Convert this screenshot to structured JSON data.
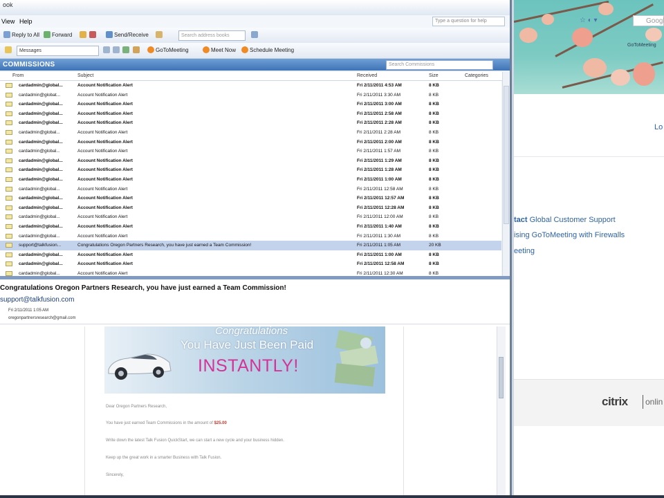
{
  "outlook": {
    "title_fragment": "ook",
    "menu": {
      "view": "View",
      "help": "Help"
    },
    "search_help_placeholder": "Type a question for help",
    "toolbar1": {
      "reply_to_all": "Reply to All",
      "forward": "Forward",
      "send_receive": "Send/Receive",
      "search_address_books": "Search address books"
    },
    "toolbar2": {
      "messages_select": "Messages",
      "gotomeeting": "GoToMeeting",
      "meet_now": "Meet Now",
      "schedule_meeting": "Schedule Meeting"
    },
    "folder": {
      "name": "COMMISSIONS",
      "search_placeholder": "Search Commissions"
    },
    "columns": {
      "from": "From",
      "subject": "Subject",
      "received": "Received",
      "size": "Size",
      "categories": "Categories"
    },
    "messages": [
      {
        "from": "cardadmin@global...",
        "subject": "Account Notification Alert",
        "received": "Fri 2/11/2011 4:53 AM",
        "size": "8 KB",
        "bold": true,
        "selected": false
      },
      {
        "from": "cardadmin@globat...",
        "subject": "Account Notification Alert",
        "received": "Fri 2/11/2011 3:30 AM",
        "size": "8 KB",
        "bold": false,
        "selected": false
      },
      {
        "from": "cardadmin@global...",
        "subject": "Account Notification Alert",
        "received": "Fri 2/11/2011 3:00 AM",
        "size": "8 KB",
        "bold": true,
        "selected": false
      },
      {
        "from": "cardadmin@global...",
        "subject": "Account Notification Alert",
        "received": "Fri 2/11/2011 2:58 AM",
        "size": "8 KB",
        "bold": true,
        "selected": false
      },
      {
        "from": "cardadmin@global...",
        "subject": "Account Notification Alert",
        "received": "Fri 2/11/2011 2:28 AM",
        "size": "8 KB",
        "bold": true,
        "selected": false
      },
      {
        "from": "cardadmin@global...",
        "subject": "Account Notification Alert",
        "received": "Fri 2/11/2011 2:28 AM",
        "size": "8 KB",
        "bold": false,
        "selected": false
      },
      {
        "from": "cardadmin@global...",
        "subject": "Account Notification Alert",
        "received": "Fri 2/11/2011 2:00 AM",
        "size": "8 KB",
        "bold": true,
        "selected": false
      },
      {
        "from": "cardadmin@global...",
        "subject": "Account Notification Alert",
        "received": "Fri 2/11/2011 1:57 AM",
        "size": "8 KB",
        "bold": false,
        "selected": false
      },
      {
        "from": "cardadmin@global...",
        "subject": "Account Notification Alert",
        "received": "Fri 2/11/2011 1:29 AM",
        "size": "8 KB",
        "bold": true,
        "selected": false
      },
      {
        "from": "cardadmin@global...",
        "subject": "Account Notification Alert",
        "received": "Fri 2/11/2011 1:28 AM",
        "size": "8 KB",
        "bold": true,
        "selected": false
      },
      {
        "from": "cardadmin@global...",
        "subject": "Account Notification Alert",
        "received": "Fri 2/11/2011 1:00 AM",
        "size": "8 KB",
        "bold": true,
        "selected": false
      },
      {
        "from": "cardadmin@global...",
        "subject": "Account Notification Alert",
        "received": "Fri 2/11/2011 12:58 AM",
        "size": "8 KB",
        "bold": false,
        "selected": false
      },
      {
        "from": "cardadmin@global...",
        "subject": "Account Notification Alert",
        "received": "Fri 2/11/2011 12:57 AM",
        "size": "8 KB",
        "bold": true,
        "selected": false
      },
      {
        "from": "cardadmin@global...",
        "subject": "Account Notification Alert",
        "received": "Fri 2/11/2011 12:28 AM",
        "size": "8 KB",
        "bold": true,
        "selected": false
      },
      {
        "from": "cardadmin@global...",
        "subject": "Account Notification Alert",
        "received": "Fri 2/11/2011 12:00 AM",
        "size": "8 KB",
        "bold": false,
        "selected": false
      },
      {
        "from": "cardadmin@global...",
        "subject": "Account Notification Alert",
        "received": "Fri 2/11/2011 1:40 AM",
        "size": "8 KB",
        "bold": true,
        "selected": false
      },
      {
        "from": "cardadmin@global...",
        "subject": "Account Notification Alert",
        "received": "Fri 2/11/2011 1:30 AM",
        "size": "8 KB",
        "bold": false,
        "selected": false
      },
      {
        "from": "support@talkfusion...",
        "subject": "Congratulations Oregon Partners Research, you have just earned a Team Commission!",
        "received": "Fri 2/11/2011 1:05 AM",
        "size": "20 KB",
        "bold": false,
        "selected": true
      },
      {
        "from": "cardadmin@global...",
        "subject": "Account Notification Alert",
        "received": "Fri 2/11/2011 1:00 AM",
        "size": "8 KB",
        "bold": true,
        "selected": false
      },
      {
        "from": "cardadmin@global...",
        "subject": "Account Notification Alert",
        "received": "Fri 2/11/2011 12:58 AM",
        "size": "8 KB",
        "bold": true,
        "selected": false
      },
      {
        "from": "cardadmin@global...",
        "subject": "Account Notification Alert",
        "received": "Fri 2/11/2011 12:30 AM",
        "size": "8 KB",
        "bold": false,
        "selected": false
      }
    ],
    "reading": {
      "subject": "Congratulations Oregon Partners Research, you have just earned a Team Commission!",
      "sender": "support@talkfusion.com",
      "sent": "Fri 2/11/2011 1:05 AM",
      "to": "oregonpartnersresearch@gmail.com",
      "banner_line1": "Congratulations",
      "banner_line2": "You Have Just Been Paid",
      "banner_line3": "INSTANTLY!",
      "greeting": "Dear Oregon Partners Research,",
      "line1_prefix": "You have just earned Team Commissions in the amount of",
      "line1_amount": "$25.00",
      "line2": "Write down the latest Talk Fusion QuickStart, we can start a new cycle and your business hidden.",
      "line3": "Keep up the great work in a smarter Business with Talk Fusion.",
      "closing": "Sincerely,"
    }
  },
  "browser": {
    "search_box": "Google",
    "header_caption": "GoToMeeting",
    "login_fragment": "Lo",
    "support_line1_lead": "tact",
    "support_line1": "Global Customer Support",
    "support_line2": "ising GoToMeeting with Firewalls",
    "support_line3": "eeting",
    "citrix_logo": "citrix",
    "citrix_online": "onlin"
  },
  "colors": {
    "outlook_header": "#3f73b6",
    "selected_row": "#c3d3ec",
    "banner_pink": "#d2359a",
    "link_blue": "#2e63a8",
    "amount_red": "#c0392b"
  }
}
